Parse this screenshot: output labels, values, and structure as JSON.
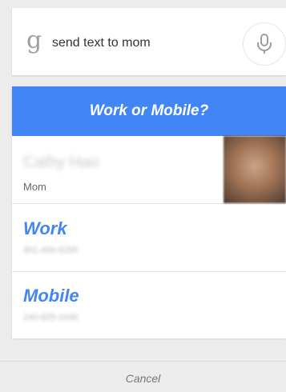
{
  "search": {
    "logo_glyph": "g",
    "query": "send text to mom",
    "mic_icon": "microphone-icon"
  },
  "dialog": {
    "title": "Work or Mobile?",
    "accent_color": "#4285f4",
    "contact": {
      "name": "Cathy Hao",
      "relation": "Mom"
    },
    "options": [
      {
        "label": "Work",
        "number": "301-456-6295"
      },
      {
        "label": "Mobile",
        "number": "240-825-1646"
      }
    ]
  },
  "footer": {
    "cancel_label": "Cancel"
  }
}
